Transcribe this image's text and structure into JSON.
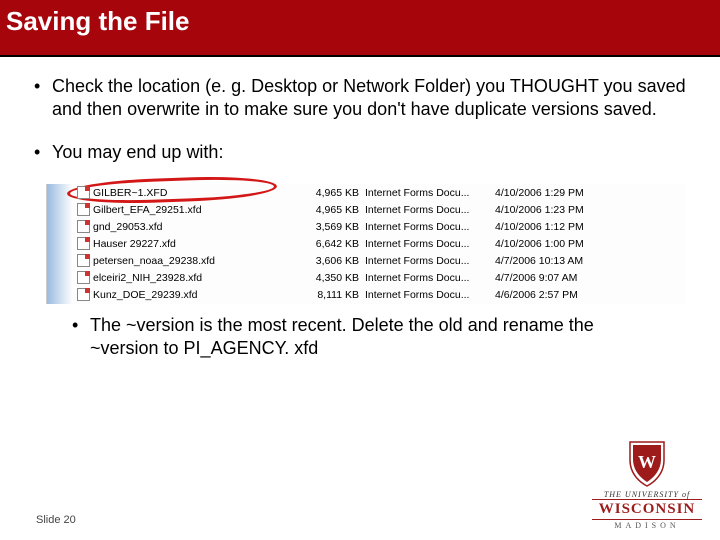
{
  "title": "Saving the File",
  "bullet1": "Check the location (e. g. Desktop or Network Folder) you THOUGHT you saved and then overwrite in to make sure you don't have duplicate versions saved.",
  "bullet2": "You may end up with:",
  "bullet3": "The ~version is the most recent.  Delete the old and rename the ~version to PI_AGENCY. xfd",
  "files": [
    {
      "name": "GILBER~1.XFD",
      "size": "4,965 KB",
      "type": "Internet Forms Docu...",
      "date": "4/10/2006 1:29 PM"
    },
    {
      "name": "Gilbert_EFA_29251.xfd",
      "size": "4,965 KB",
      "type": "Internet Forms Docu...",
      "date": "4/10/2006 1:23 PM"
    },
    {
      "name": "gnd_29053.xfd",
      "size": "3,569 KB",
      "type": "Internet Forms Docu...",
      "date": "4/10/2006 1:12 PM"
    },
    {
      "name": "Hauser 29227.xfd",
      "size": "6,642 KB",
      "type": "Internet Forms Docu...",
      "date": "4/10/2006 1:00 PM"
    },
    {
      "name": "petersen_noaa_29238.xfd",
      "size": "3,606 KB",
      "type": "Internet Forms Docu...",
      "date": "4/7/2006 10:13 AM"
    },
    {
      "name": "elceiri2_NIH_23928.xfd",
      "size": "4,350 KB",
      "type": "Internet Forms Docu...",
      "date": "4/7/2006 9:07 AM"
    },
    {
      "name": "Kunz_DOE_29239.xfd",
      "size": "8,111 KB",
      "type": "Internet Forms Docu...",
      "date": "4/6/2006 2:57 PM"
    }
  ],
  "slide_label": "Slide 20",
  "logo": {
    "line1": "THE UNIVERSITY",
    "line2": "WISCONSIN",
    "line3": "MADISON",
    "of": "of"
  }
}
